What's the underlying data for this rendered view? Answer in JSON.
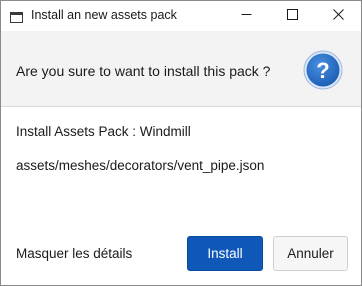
{
  "window": {
    "title": "Install an new assets pack",
    "controls": {
      "minimize": "minimize-icon",
      "maximize": "maximize-icon",
      "close": "close-icon"
    }
  },
  "header": {
    "question": "Are you sure to want to install this pack ?",
    "icon": "question-icon",
    "icon_color": "#1a63b8"
  },
  "content": {
    "pack_line": "Install Assets Pack : Windmill",
    "file_path": "assets/meshes/decorators/vent_pipe.json"
  },
  "footer": {
    "details_toggle": "Masquer les détails",
    "install_label": "Install",
    "cancel_label": "Annuler",
    "install_color": "#0f58b8"
  }
}
